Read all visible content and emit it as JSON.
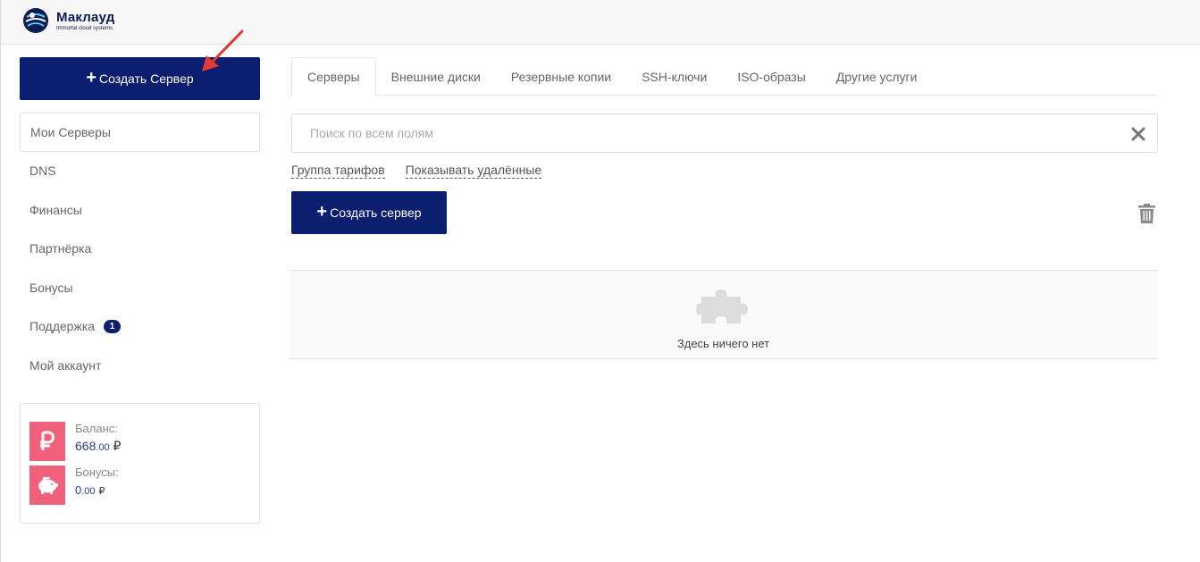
{
  "header": {
    "logo_name": "Маклауд",
    "logo_tagline": "Immortal cloud systems",
    "logo_icon": "cloud-logo-icon"
  },
  "sidebar": {
    "create_button": "Создать Сервер",
    "items": [
      {
        "label": "Мои Серверы",
        "active": true
      },
      {
        "label": "DNS"
      },
      {
        "label": "Финансы"
      },
      {
        "label": "Партнёрка"
      },
      {
        "label": "Бонусы"
      },
      {
        "label": "Поддержка",
        "badge": "1"
      },
      {
        "label": "Мой аккаунт"
      }
    ],
    "balance": {
      "label": "Баланс:",
      "amount_int": "668",
      "amount_frac": ".00",
      "currency": "₽",
      "icon": "ruble-icon"
    },
    "bonuses": {
      "label": "Бонусы:",
      "amount_int": "0",
      "amount_frac": ".00",
      "currency": "₽",
      "icon": "piggy-bank-icon"
    }
  },
  "main": {
    "tabs": [
      {
        "label": "Серверы",
        "active": true
      },
      {
        "label": "Внешние диски"
      },
      {
        "label": "Резервные копии"
      },
      {
        "label": "SSH-ключи"
      },
      {
        "label": "ISO-образы"
      },
      {
        "label": "Другие услуги"
      }
    ],
    "search": {
      "placeholder": "Поиск по всем полям",
      "value": ""
    },
    "links": {
      "tariff_group": "Группа тарифов",
      "show_deleted": "Показывать удалённые"
    },
    "create_button": "Создать сервер",
    "empty_text": "Здесь ничего нет"
  },
  "colors": {
    "primary": "#0b1f6e",
    "accent_pink": "#f0607a",
    "annotation_arrow": "#e53935"
  }
}
